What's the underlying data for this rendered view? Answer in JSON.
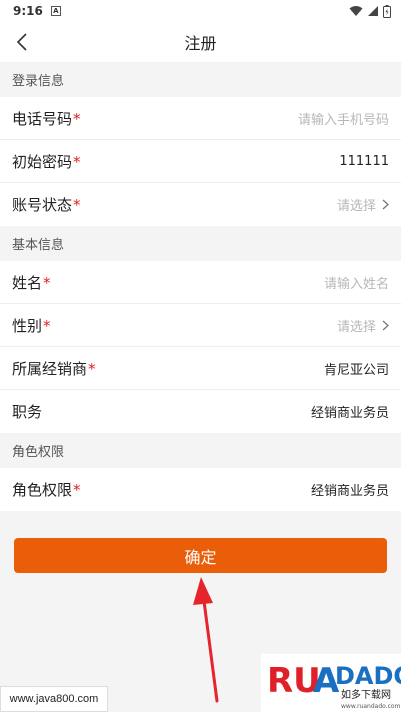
{
  "status_bar": {
    "time": "9:16",
    "notif_icon": "A"
  },
  "nav": {
    "title": "注册"
  },
  "sections": {
    "login": "登录信息",
    "basic": "基本信息",
    "role": "角色权限"
  },
  "login_fields": {
    "phone": {
      "label": "电话号码",
      "placeholder": "请输入手机号码"
    },
    "password": {
      "label": "初始密码",
      "value": "111111"
    },
    "account_status": {
      "label": "账号状态",
      "placeholder": "请选择"
    }
  },
  "basic_fields": {
    "name": {
      "label": "姓名",
      "placeholder": "请输入姓名"
    },
    "gender": {
      "label": "性别",
      "placeholder": "请选择"
    },
    "dealer": {
      "label": "所属经销商",
      "value": "肯尼亚公司"
    },
    "position": {
      "label": "职务",
      "value": "经销商业务员"
    }
  },
  "role_fields": {
    "role": {
      "label": "角色权限",
      "value": "经销商业务员"
    }
  },
  "required_mark": "*",
  "confirm_label": "确定",
  "watermark": {
    "left_text": "www.java800.com",
    "right_brand": "RUANDADO",
    "right_sub": "如多下载网",
    "right_url": "www.ruandado.com"
  },
  "colors": {
    "accent": "#ea5d09",
    "required": "#e02020"
  }
}
